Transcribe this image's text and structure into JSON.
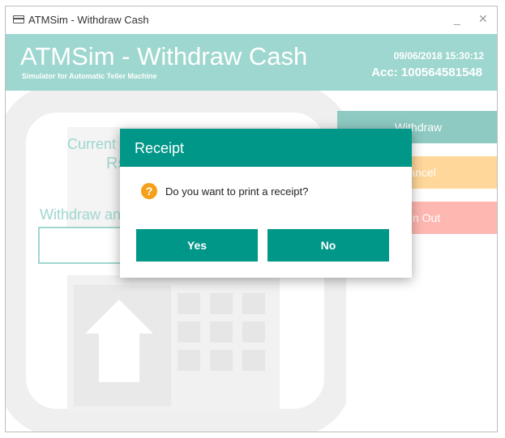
{
  "window": {
    "title": "ATMSim - Withdraw Cash",
    "minimize_label": "_",
    "close_label": "✕"
  },
  "header": {
    "title": "ATMSim - Withdraw Cash",
    "subtitle": "Simulator for Automatic Teller Machine",
    "datetime": "09/06/2018 15:30:12",
    "account": "Acc: 100564581548"
  },
  "main": {
    "current_label_partial": "Current",
    "currency_partial": "Rs",
    "withdraw_label_partial": "Withdraw an",
    "amount_value": ""
  },
  "actions": {
    "withdraw": "Withdraw",
    "cancel": "Cancel",
    "signout": "Sign Out"
  },
  "dialog": {
    "title": "Receipt",
    "message": "Do you want to print a receipt?",
    "icon": "question-icon",
    "yes": "Yes",
    "no": "No"
  },
  "colors": {
    "header": "#9ed7cf",
    "dialog_accent": "#009688",
    "withdraw_button": "#8ecac2",
    "cancel_button": "#ffd79a",
    "signout_button": "#ffb7b1"
  }
}
